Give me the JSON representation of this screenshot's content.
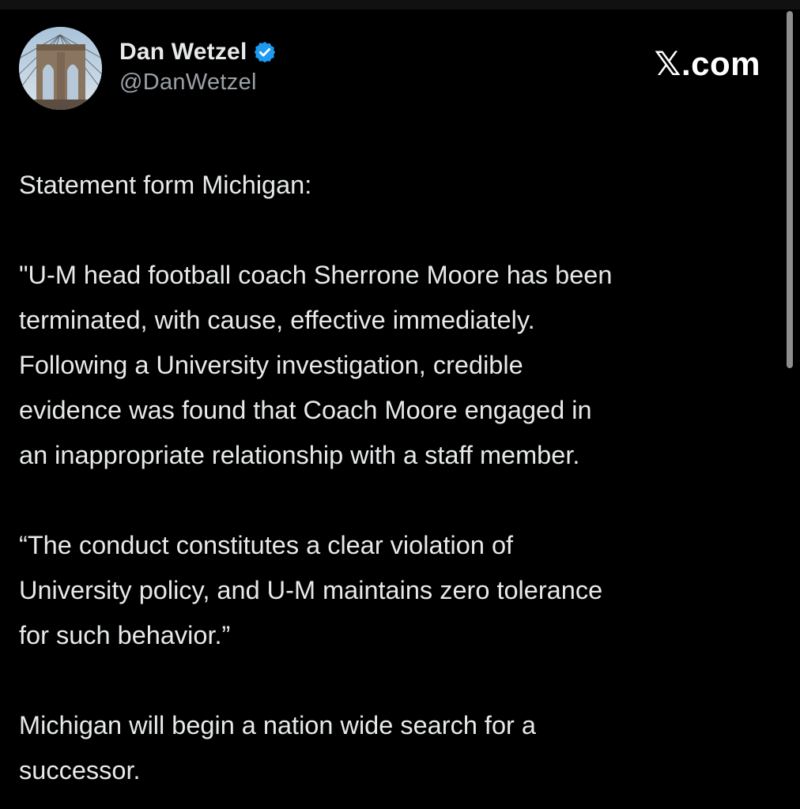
{
  "author": {
    "display_name": "Dan Wetzel",
    "handle": "@DanWetzel",
    "verified": true,
    "avatar_icon": "brooklyn-bridge-photo"
  },
  "brand": {
    "logo_text": "𝕏.com"
  },
  "colors": {
    "background": "#000000",
    "text": "#e7e9ea",
    "secondary_text": "#9ba0a6",
    "verified_badge": "#1d9bf0"
  },
  "post": {
    "paragraphs": [
      {
        "lines": [
          "Statement form Michigan:"
        ]
      },
      {
        "lines": [
          "\"U-M head football coach Sherrone Moore has been",
          "terminated, with cause, effective immediately.",
          "Following a University investigation, credible",
          "evidence was found that Coach Moore engaged in",
          "an inappropriate relationship with a staff member."
        ]
      },
      {
        "lines": [
          "“The conduct constitutes a clear violation of",
          "University policy, and U-M maintains zero tolerance",
          "for such behavior.”"
        ]
      },
      {
        "lines": [
          "Michigan will begin a nation wide search for a",
          "successor."
        ]
      }
    ]
  }
}
